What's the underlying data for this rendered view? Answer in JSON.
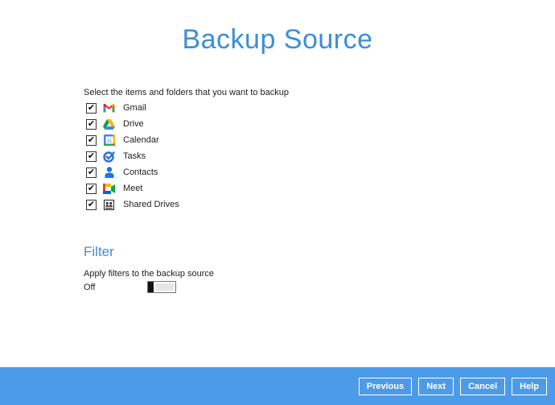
{
  "title": "Backup Source",
  "instruction": "Select the items and folders that you want to backup",
  "items": [
    {
      "label": "Gmail",
      "checked": true,
      "icon": "gmail-icon"
    },
    {
      "label": "Drive",
      "checked": true,
      "icon": "drive-icon"
    },
    {
      "label": "Calendar",
      "checked": true,
      "icon": "calendar-icon"
    },
    {
      "label": "Tasks",
      "checked": true,
      "icon": "tasks-icon"
    },
    {
      "label": "Contacts",
      "checked": true,
      "icon": "contacts-icon"
    },
    {
      "label": "Meet",
      "checked": true,
      "icon": "meet-icon"
    },
    {
      "label": "Shared Drives",
      "checked": true,
      "icon": "shared-drives-icon"
    }
  ],
  "filter": {
    "heading": "Filter",
    "description": "Apply filters to the backup source",
    "state_label": "Off",
    "enabled": false
  },
  "footer": {
    "previous": "Previous",
    "next": "Next",
    "cancel": "Cancel",
    "help": "Help"
  },
  "colors": {
    "accent": "#3b8fd6",
    "footer_bg": "#4c9be8"
  }
}
